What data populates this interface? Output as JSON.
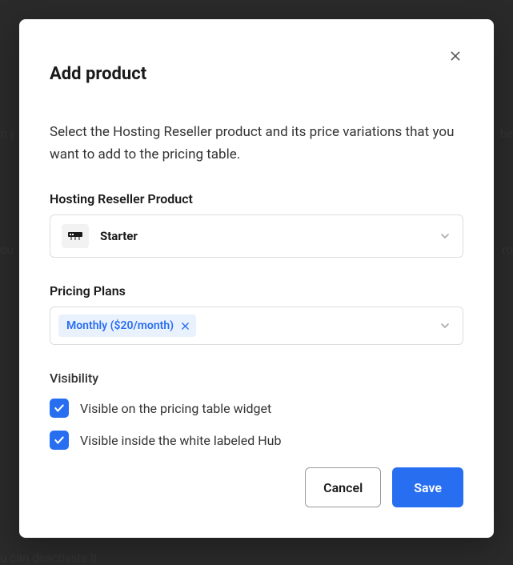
{
  "modal": {
    "title": "Add product",
    "description": "Select the Hosting Reseller product and its price variations that you want to add to the pricing table.",
    "product_section": {
      "label": "Hosting Reseller Product",
      "selected": "Starter"
    },
    "plans_section": {
      "label": "Pricing Plans",
      "chips": [
        {
          "label": "Monthly ($20/month)"
        }
      ]
    },
    "visibility_section": {
      "label": "Visibility",
      "options": [
        {
          "label": "Visible on the pricing table widget",
          "checked": true
        },
        {
          "label": "Visible inside the white labeled Hub",
          "checked": true
        }
      ]
    },
    "footer": {
      "cancel": "Cancel",
      "save": "Save"
    }
  }
}
